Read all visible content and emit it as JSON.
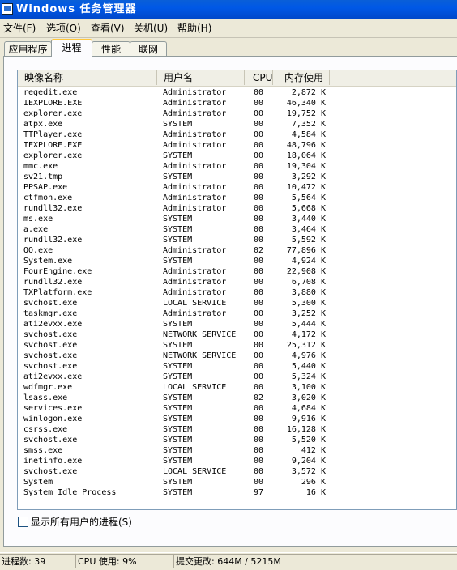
{
  "window": {
    "title": "Windows 任务管理器"
  },
  "menu": [
    "文件(F)",
    "选项(O)",
    "查看(V)",
    "关机(U)",
    "帮助(H)"
  ],
  "tabs": [
    "应用程序",
    "进程",
    "性能",
    "联网"
  ],
  "active_tab": "进程",
  "columns": [
    "映像名称",
    "用户名",
    "CPU",
    "内存使用"
  ],
  "processes": [
    {
      "name": "regedit.exe",
      "user": "Administrator",
      "cpu": "00",
      "mem": "2,872 K"
    },
    {
      "name": "IEXPLORE.EXE",
      "user": "Administrator",
      "cpu": "00",
      "mem": "46,340 K"
    },
    {
      "name": "explorer.exe",
      "user": "Administrator",
      "cpu": "00",
      "mem": "19,752 K"
    },
    {
      "name": "atpx.exe",
      "user": "SYSTEM",
      "cpu": "00",
      "mem": "7,352 K"
    },
    {
      "name": "TTPlayer.exe",
      "user": "Administrator",
      "cpu": "00",
      "mem": "4,584 K"
    },
    {
      "name": "IEXPLORE.EXE",
      "user": "Administrator",
      "cpu": "00",
      "mem": "48,796 K"
    },
    {
      "name": "explorer.exe",
      "user": "SYSTEM",
      "cpu": "00",
      "mem": "18,064 K"
    },
    {
      "name": "mmc.exe",
      "user": "Administrator",
      "cpu": "00",
      "mem": "19,304 K"
    },
    {
      "name": "sv21.tmp",
      "user": "SYSTEM",
      "cpu": "00",
      "mem": "3,292 K"
    },
    {
      "name": "PPSAP.exe",
      "user": "Administrator",
      "cpu": "00",
      "mem": "10,472 K"
    },
    {
      "name": "ctfmon.exe",
      "user": "Administrator",
      "cpu": "00",
      "mem": "5,564 K"
    },
    {
      "name": "rundll32.exe",
      "user": "Administrator",
      "cpu": "00",
      "mem": "5,668 K"
    },
    {
      "name": "ms.exe",
      "user": "SYSTEM",
      "cpu": "00",
      "mem": "3,440 K"
    },
    {
      "name": "a.exe",
      "user": "SYSTEM",
      "cpu": "00",
      "mem": "3,464 K"
    },
    {
      "name": "rundll32.exe",
      "user": "SYSTEM",
      "cpu": "00",
      "mem": "5,592 K"
    },
    {
      "name": "QQ.exe",
      "user": "Administrator",
      "cpu": "02",
      "mem": "77,896 K"
    },
    {
      "name": "System.exe",
      "user": "SYSTEM",
      "cpu": "00",
      "mem": "4,924 K"
    },
    {
      "name": "FourEngine.exe",
      "user": "Administrator",
      "cpu": "00",
      "mem": "22,908 K"
    },
    {
      "name": "rundll32.exe",
      "user": "Administrator",
      "cpu": "00",
      "mem": "6,708 K"
    },
    {
      "name": "TXPlatform.exe",
      "user": "Administrator",
      "cpu": "00",
      "mem": "3,880 K"
    },
    {
      "name": "svchost.exe",
      "user": "LOCAL SERVICE",
      "cpu": "00",
      "mem": "5,300 K"
    },
    {
      "name": "taskmgr.exe",
      "user": "Administrator",
      "cpu": "00",
      "mem": "3,252 K"
    },
    {
      "name": "ati2evxx.exe",
      "user": "SYSTEM",
      "cpu": "00",
      "mem": "5,444 K"
    },
    {
      "name": "svchost.exe",
      "user": "NETWORK SERVICE",
      "cpu": "00",
      "mem": "4,172 K"
    },
    {
      "name": "svchost.exe",
      "user": "SYSTEM",
      "cpu": "00",
      "mem": "25,312 K"
    },
    {
      "name": "svchost.exe",
      "user": "NETWORK SERVICE",
      "cpu": "00",
      "mem": "4,976 K"
    },
    {
      "name": "svchost.exe",
      "user": "SYSTEM",
      "cpu": "00",
      "mem": "5,440 K"
    },
    {
      "name": "ati2evxx.exe",
      "user": "SYSTEM",
      "cpu": "00",
      "mem": "5,324 K"
    },
    {
      "name": "wdfmgr.exe",
      "user": "LOCAL SERVICE",
      "cpu": "00",
      "mem": "3,100 K"
    },
    {
      "name": "lsass.exe",
      "user": "SYSTEM",
      "cpu": "02",
      "mem": "3,020 K"
    },
    {
      "name": "services.exe",
      "user": "SYSTEM",
      "cpu": "00",
      "mem": "4,684 K"
    },
    {
      "name": "winlogon.exe",
      "user": "SYSTEM",
      "cpu": "00",
      "mem": "9,916 K"
    },
    {
      "name": "csrss.exe",
      "user": "SYSTEM",
      "cpu": "00",
      "mem": "16,128 K"
    },
    {
      "name": "svchost.exe",
      "user": "SYSTEM",
      "cpu": "00",
      "mem": "5,520 K"
    },
    {
      "name": "smss.exe",
      "user": "SYSTEM",
      "cpu": "00",
      "mem": "412 K"
    },
    {
      "name": "inetinfo.exe",
      "user": "SYSTEM",
      "cpu": "00",
      "mem": "9,204 K"
    },
    {
      "name": "svchost.exe",
      "user": "LOCAL SERVICE",
      "cpu": "00",
      "mem": "3,572 K"
    },
    {
      "name": "System",
      "user": "SYSTEM",
      "cpu": "00",
      "mem": "296 K"
    },
    {
      "name": "System Idle Process",
      "user": "SYSTEM",
      "cpu": "97",
      "mem": "16 K"
    }
  ],
  "show_all_users": {
    "label": "显示所有用户的进程(S)",
    "checked": false
  },
  "status": {
    "process_count": "进程数: 39",
    "cpu_usage": "CPU 使用: 9%",
    "commit_charge": "提交更改: 644M / 5215M"
  }
}
